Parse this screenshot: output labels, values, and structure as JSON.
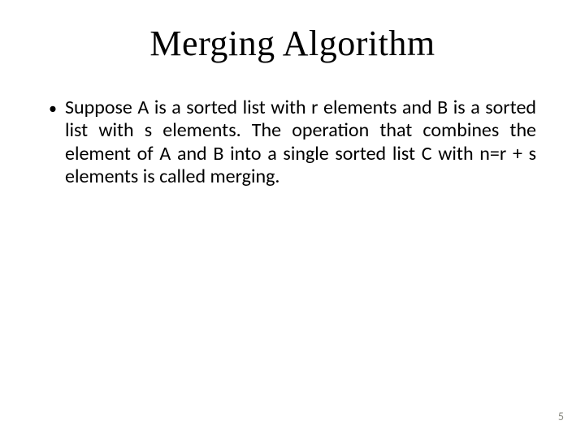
{
  "slide": {
    "title": "Merging Algorithm",
    "bullet_glyph": "•",
    "body": "Suppose A is a sorted list with r elements and B is a sorted list with s elements. The operation that combines the element of A and B into a single sorted list C with n=r + s elements is called merging.",
    "page_number": "5"
  }
}
